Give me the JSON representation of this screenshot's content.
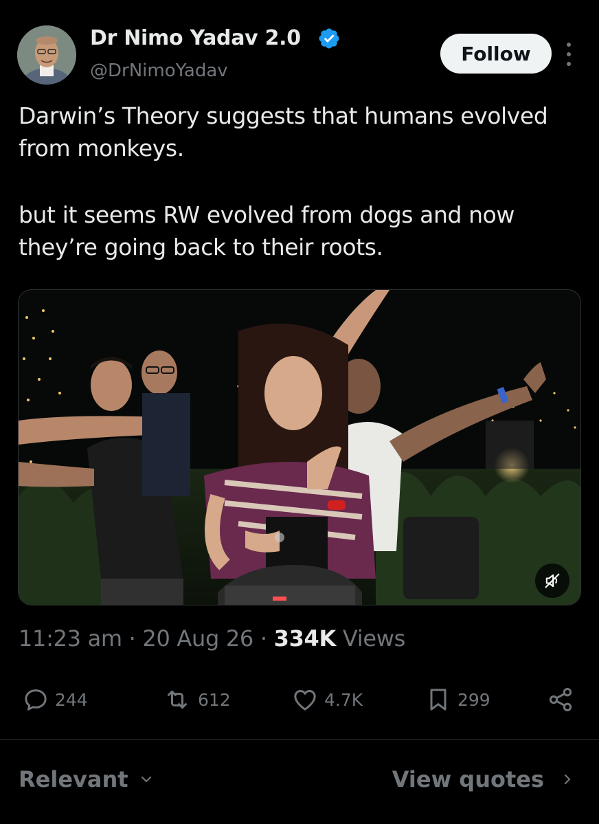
{
  "author": {
    "display_name": "Dr Nimo Yadav 2.0",
    "handle": "@DrNimoYadav",
    "verified": true,
    "verified_color": "#1d9bf0"
  },
  "follow_label": "Follow",
  "tweet": {
    "paragraphs": [
      "Darwin’s Theory suggests that humans evolved from monkeys.",
      "but it seems RW evolved from dogs and now they’re going back to their roots."
    ]
  },
  "media": {
    "type": "video",
    "mute_icon": "speaker-muted-icon"
  },
  "meta": {
    "time": "11:23 am",
    "separator": " · ",
    "date": "20 Aug 26",
    "views_count": "334K",
    "views_label": " Views"
  },
  "actions": {
    "replies": "244",
    "reposts": "612",
    "likes": "4.7K",
    "bookmarks": "299"
  },
  "footer": {
    "sort_label": "Relevant",
    "quotes_label": "View quotes"
  },
  "colors": {
    "background": "#000000",
    "text": "#e7e9ea",
    "secondary": "#71767b",
    "divider": "#2f3336",
    "follow_bg": "#eff3f4"
  }
}
